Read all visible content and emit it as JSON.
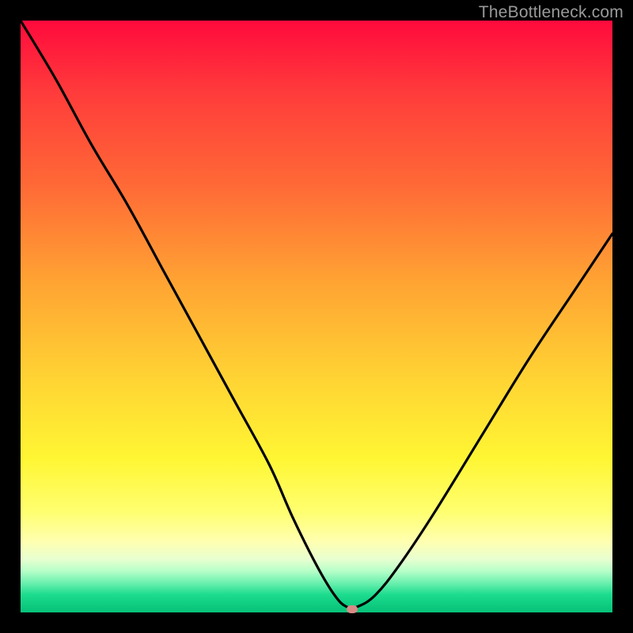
{
  "attribution": "TheBottleneck.com",
  "colors": {
    "background": "#000000",
    "curve": "#000000",
    "marker": "#d88b86",
    "gradient_top": "#ff0a3c",
    "gradient_bottom": "#08c37a"
  },
  "chart_data": {
    "type": "line",
    "title": "",
    "xlabel": "",
    "ylabel": "",
    "xlim": [
      0,
      100
    ],
    "ylim": [
      0,
      100
    ],
    "grid": false,
    "series": [
      {
        "name": "bottleneck-curve",
        "x": [
          0,
          6,
          12,
          18,
          24,
          30,
          36,
          42,
          46,
          50,
          53,
          55,
          57,
          60,
          64,
          70,
          78,
          86,
          94,
          100
        ],
        "values": [
          100,
          90,
          79,
          69,
          58,
          47,
          36,
          25,
          16,
          8,
          3,
          1,
          1,
          3,
          8,
          17,
          30,
          43,
          55,
          64
        ]
      }
    ],
    "annotations": [
      {
        "name": "optimal-marker",
        "x": 56,
        "y": 0.5
      }
    ]
  }
}
